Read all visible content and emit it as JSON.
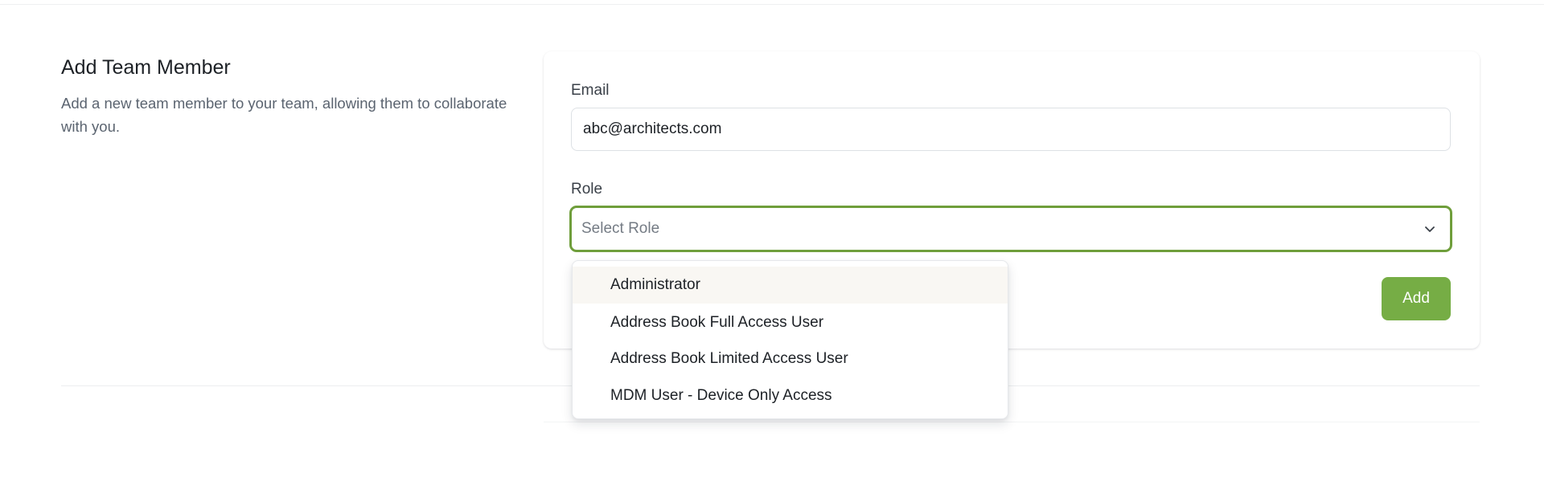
{
  "section": {
    "title": "Add Team Member",
    "description": "Add a new team member to your team, allowing them to collaborate with you."
  },
  "form": {
    "email_label": "Email",
    "email_value": "abc@architects.com",
    "role_label": "Role",
    "role_placeholder": "Select Role",
    "add_label": "Add"
  },
  "role_options": [
    "Administrator",
    "Address Book Full Access User",
    "Address Book Limited Access User",
    "MDM User - Device Only Access"
  ],
  "highlighted_option": "Administrator",
  "colors": {
    "accent": "#76ad45",
    "focus_border": "#6f9e3b",
    "highlight_bg": "#f9f7f3"
  },
  "icons": {
    "select_indicator": "chevron-down-icon"
  }
}
